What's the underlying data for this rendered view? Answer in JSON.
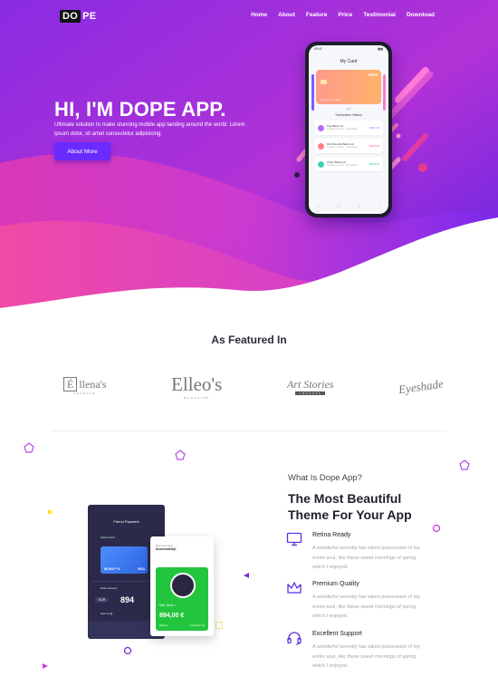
{
  "header": {
    "logo_left": "DO",
    "logo_right": "PE",
    "nav": [
      "Home",
      "About",
      "Feature",
      "Price",
      "Testimonial",
      "Download"
    ]
  },
  "hero": {
    "title": "HI, I'M DOPE APP.",
    "subtitle": "Ultimate solution to make stunning mobile app landing around the world. Lorem ipsum dolor, sit amet consectetur adipisicing.",
    "button": "About More"
  },
  "phone": {
    "time": "09:41",
    "title": "My Card",
    "card_brand": "VISA",
    "card_number": "••••  ••••  ••••  1236",
    "dots": "•••",
    "history_title": "Transaction History",
    "transactions": [
      {
        "name": "City Bank Ltd",
        "sub": "Transfer to save · Completed",
        "amount": "$500.00",
        "color": "#b86bff",
        "amount_color": "#b86bff"
      },
      {
        "name": "First Bounds Bank Ltd",
        "sub": "Transfer to save · Completed",
        "amount": "$150.00",
        "color": "#ff7b8a",
        "amount_color": "#ff5a6a"
      },
      {
        "name": "Union Bank Ltd",
        "sub": "Transfer to save · Completed",
        "amount": "$100.00",
        "color": "#3fd1b0",
        "amount_color": "#2bc3a0"
      }
    ]
  },
  "featured": {
    "title": "As Featured In",
    "brands": [
      {
        "box": "É",
        "name": "llena's",
        "tag": "FASHION"
      },
      {
        "name": "Elleo's",
        "tag": "MAGAZINE"
      },
      {
        "name": "Art Stories",
        "tag": "CHANNEL"
      },
      {
        "name": "Eyeshade"
      }
    ]
  },
  "features": {
    "kicker": "What Is Dope App?",
    "title": "The Most Beautiful Theme For Your App",
    "items": [
      {
        "name": "Retina Ready",
        "icon": "monitor-icon",
        "desc": "A wonderful serenity has taken possession of my entire soul, like these sweet mornings of spring which I enjoyed."
      },
      {
        "name": "Premium Quality",
        "icon": "crown-icon",
        "desc": "A wonderful serenity has taken possession of my entire soul, like these sweet mornings of spring which I enjoyed."
      },
      {
        "name": "Excellent Support",
        "icon": "headset-icon",
        "desc": "A wonderful serenity has taken possession of my entire soul, like these sweet mornings of spring which I enjoyed."
      }
    ]
  },
  "mockup": {
    "left_title": "Friend Payment",
    "left_select": "Select Card",
    "left_card_amount": "$6,903 ** €",
    "left_card_brand": "VISA",
    "left_enter": "Enter Amount",
    "left_currency": "EUR",
    "left_big": "894",
    "left_sent": "Sent to @",
    "right_label": "Payment Sent",
    "right_status": "Successfully!",
    "right_name": "Mitt. Shoe •",
    "right_amount": "894,00 €",
    "right_footer_left": "Balance",
    "right_footer_right": "Transaction ID"
  },
  "colors": {
    "accent": "#6a2bff",
    "hero_top": "#8e2bea",
    "hero_bottom": "#e83aa6",
    "icon_purple": "#5b2fe0"
  }
}
